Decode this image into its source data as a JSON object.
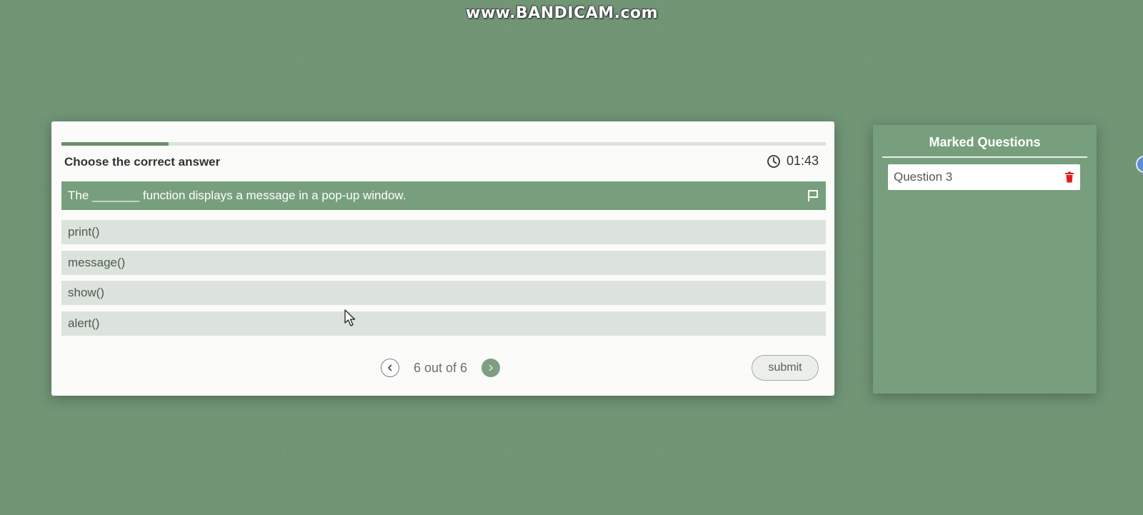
{
  "watermark": {
    "text": "www.BANDICAM.com"
  },
  "quiz": {
    "progress_fraction": 0.14,
    "instruction": "Choose the correct answer",
    "timer": {
      "icon": "clock-icon",
      "value": "01:43"
    },
    "question": {
      "text": "The _______ function displays a message in a pop-up window.",
      "flag_icon": "flag-icon"
    },
    "options": [
      {
        "label": "print()"
      },
      {
        "label": "message()"
      },
      {
        "label": "show()"
      },
      {
        "label": "alert()"
      }
    ],
    "pager": {
      "text": "6 out of 6",
      "prev_icon": "chevron-left-icon",
      "next_icon": "chevron-right-icon"
    },
    "submit_label": "submit"
  },
  "marked_panel": {
    "title": "Marked Questions",
    "items": [
      {
        "label": "Question 3",
        "delete_icon": "trash-icon"
      }
    ]
  },
  "colors": {
    "background": "#6f9474",
    "accent": "#789f7d",
    "option_bg": "#dbe3dc",
    "delete": "#e01e1e"
  }
}
